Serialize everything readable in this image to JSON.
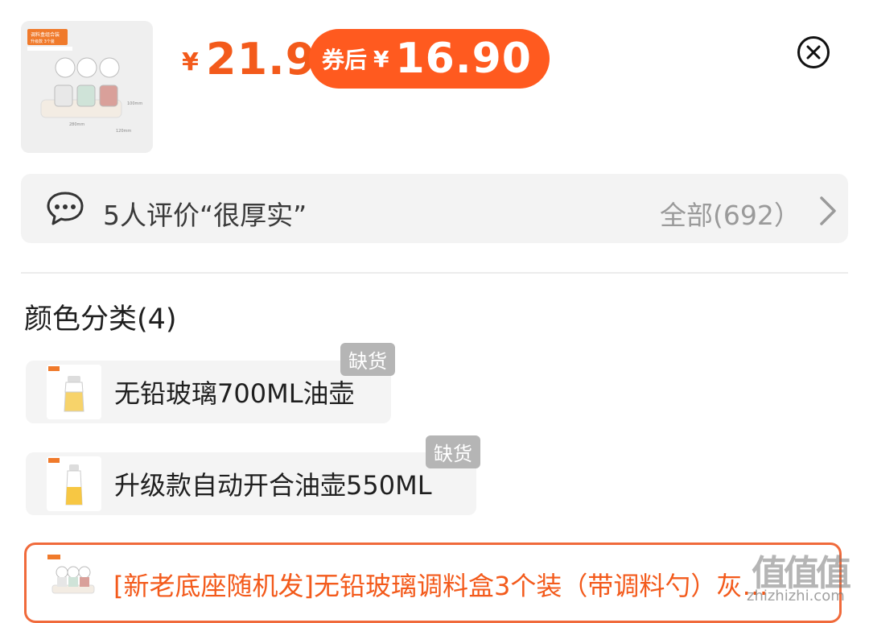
{
  "header": {
    "yen_symbol": "¥",
    "price": "21.9",
    "coupon_label": "券后",
    "coupon_yen": "¥",
    "coupon_price": "16.90",
    "thumb_caption_top": "调料盒组合装",
    "thumb_caption_sub": "升级款 3个装",
    "thumb_dim_w": "280mm",
    "thumb_dim_d": "120mm",
    "thumb_dim_h": "100mm"
  },
  "review": {
    "text": "5人评价“很厚实”",
    "all_label": "全部(692）"
  },
  "section": {
    "title": "颜色分类(4)"
  },
  "options": [
    {
      "label": "无铅玻璃700ML油壶",
      "badge": "缺货"
    },
    {
      "label": "升级款自动开合油壶550ML",
      "badge": "缺货"
    },
    {
      "label": "[新老底座随机发]无铅玻璃调料盒3个装（带调料勺）灰…"
    }
  ],
  "watermark": {
    "glyphs": "值值值",
    "url": "zhizhizhi.com"
  },
  "colors": {
    "accent": "#f35a1b",
    "coupon_bg": "#ff5a1f",
    "badge_bg": "#b5b5b5"
  }
}
